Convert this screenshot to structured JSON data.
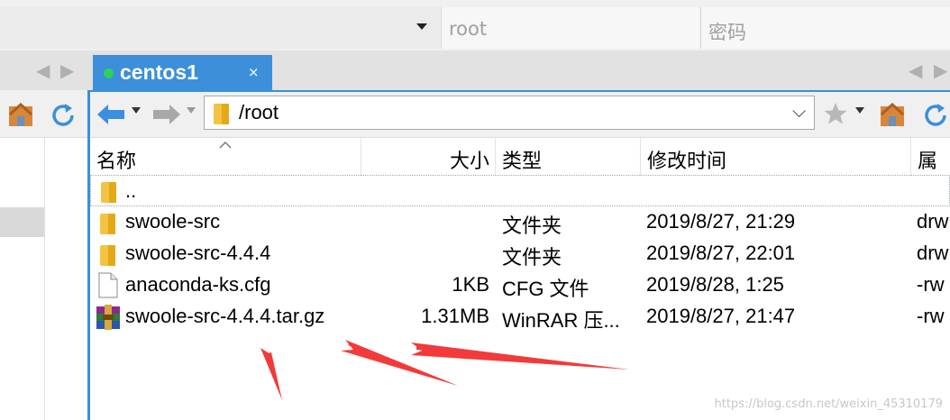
{
  "login": {
    "user_placeholder": "root",
    "password_placeholder": "密码"
  },
  "tab": {
    "label": "centos1",
    "close": "×",
    "status_color": "#2fd05c"
  },
  "path": {
    "value": "/root"
  },
  "columns": {
    "name": "名称",
    "size": "大小",
    "type": "类型",
    "modified": "修改时间",
    "attributes": "属性"
  },
  "files": [
    {
      "icon": "folder-icon",
      "name": "..",
      "size": "",
      "type": "",
      "modified": "",
      "attributes": ""
    },
    {
      "icon": "folder-icon",
      "name": "swoole-src",
      "size": "",
      "type": "文件夹",
      "modified": "2019/8/27, 21:29",
      "attributes": "drw"
    },
    {
      "icon": "folder-icon",
      "name": "swoole-src-4.4.4",
      "size": "",
      "type": "文件夹",
      "modified": "2019/8/27, 22:01",
      "attributes": "drw"
    },
    {
      "icon": "document-icon",
      "name": "anaconda-ks.cfg",
      "size": "1KB",
      "type": "CFG 文件",
      "modified": "2019/8/28, 1:25",
      "attributes": "-rw"
    },
    {
      "icon": "winrar-archive-icon",
      "name": "swoole-src-4.4.4.tar.gz",
      "size": "1.31MB",
      "type": "WinRAR 压...",
      "modified": "2019/8/27, 21:47",
      "attributes": "-rw"
    }
  ],
  "watermark": "https://blog.csdn.net/weixin_45310179",
  "colors": {
    "tab_blue": "#3c8fd8",
    "annotation_red": "#f23a3a",
    "folder_yellow": "#f3c343"
  }
}
